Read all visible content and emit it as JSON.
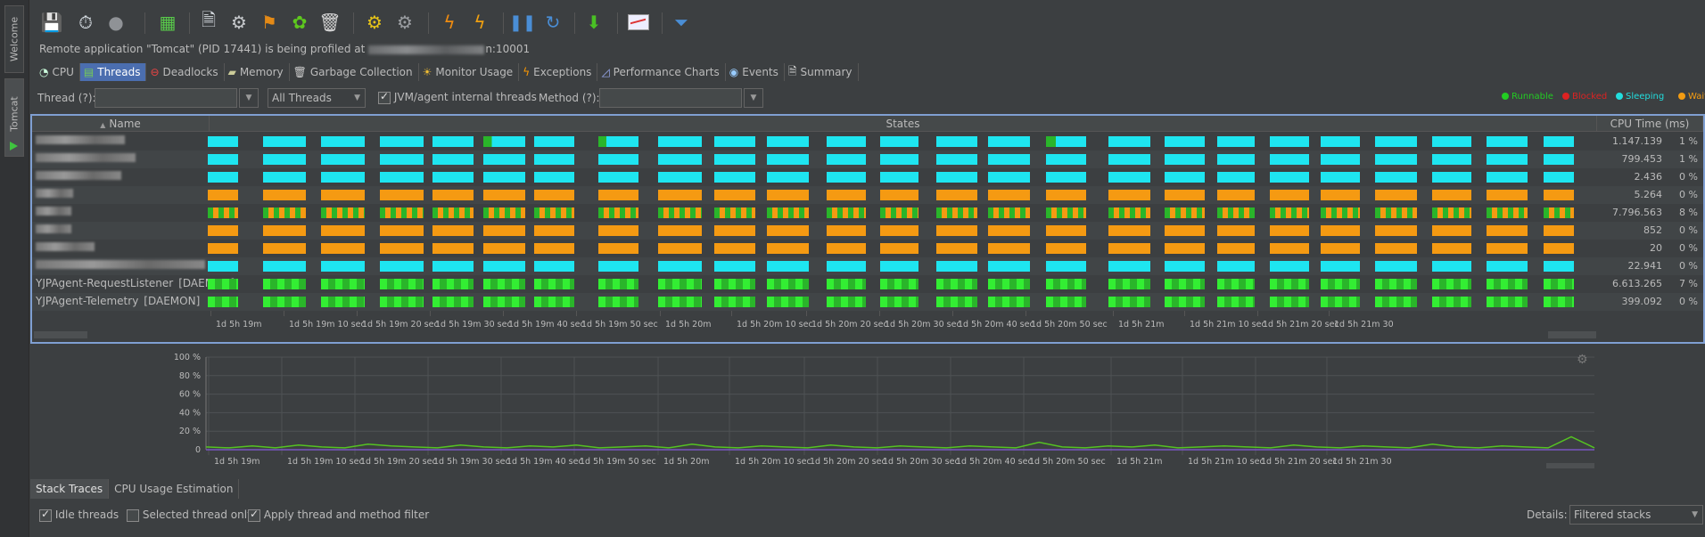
{
  "side_tabs": {
    "welcome": "Welcome",
    "tomcat": "Tomcat"
  },
  "toolbar": {
    "icons": [
      "save-snapshot-icon",
      "capture-performance-icon",
      "capture-memory-icon",
      "memory-snapshot-icon",
      "export-icon",
      "run-gc-icon",
      "flag-icon",
      "settings-gears-icon",
      "trash-icon",
      "cpu-gear-icon",
      "gear-icon",
      "lightning-icon",
      "lightning-star-icon",
      "pause-icon",
      "refresh-icon",
      "download-arrow-icon",
      "chart-icon",
      "filter-icon"
    ]
  },
  "status": {
    "prefix": "Remote application \"Tomcat\" (PID 17441) is being profiled at",
    "suffix": "n:10001"
  },
  "tabs": [
    {
      "label": "CPU",
      "icon": "cpu-icon",
      "active": false
    },
    {
      "label": "Threads",
      "icon": "threads-icon",
      "active": true
    },
    {
      "label": "Deadlocks",
      "icon": "deadlock-icon",
      "active": false
    },
    {
      "label": "Memory",
      "icon": "memory-icon",
      "active": false
    },
    {
      "label": "Garbage Collection",
      "icon": "gc-icon",
      "active": false
    },
    {
      "label": "Monitor Usage",
      "icon": "monitor-icon",
      "active": false
    },
    {
      "label": "Exceptions",
      "icon": "exception-icon",
      "active": false
    },
    {
      "label": "Performance Charts",
      "icon": "charts-icon",
      "active": false
    },
    {
      "label": "Events",
      "icon": "events-icon",
      "active": false
    },
    {
      "label": "Summary",
      "icon": "summary-icon",
      "active": false
    }
  ],
  "filter": {
    "thread_label": "Thread (?):",
    "thread_value": "",
    "thread_scope": "All Threads",
    "jvm_checkbox_label": "JVM/agent internal threads",
    "jvm_checked": true,
    "method_label": "Method (?):",
    "method_value": ""
  },
  "legend": [
    {
      "label": "Runnable",
      "color": "#22cc22"
    },
    {
      "label": "Blocked",
      "color": "#dd2222"
    },
    {
      "label": "Sleeping",
      "color": "#22dddd"
    },
    {
      "label": "Waiting",
      "color": "#f39c12"
    }
  ],
  "colors": {
    "runnable": "#2ab52a",
    "runnable_bright": "#33ee33",
    "sleeping": "#1ee5f0",
    "waiting": "#f59a12"
  },
  "table": {
    "headers": {
      "name": "Name",
      "states": "States",
      "cpu": "CPU Time (ms)"
    },
    "rows": [
      {
        "name": "",
        "blurred": true,
        "state": "sleeping",
        "cpu": "1.147.139",
        "pct": "1 %"
      },
      {
        "name": "",
        "blurred": true,
        "state": "sleeping",
        "cpu": "799.453",
        "pct": "1 %"
      },
      {
        "name": "",
        "blurred": true,
        "state": "sleeping",
        "cpu": "2.436",
        "pct": "0 %"
      },
      {
        "name": "",
        "blurred": true,
        "state": "waiting",
        "cpu": "5.264",
        "pct": "0 %"
      },
      {
        "name": "",
        "blurred": true,
        "state": "mixed",
        "cpu": "7.796.563",
        "pct": "8 %"
      },
      {
        "name": "",
        "blurred": true,
        "state": "waiting",
        "cpu": "852",
        "pct": "0 %"
      },
      {
        "name": "",
        "blurred": true,
        "state": "waiting",
        "cpu": "20",
        "pct": "0 %"
      },
      {
        "name": "",
        "blurred": true,
        "state": "sleeping",
        "cpu": "22.941",
        "pct": "0 %"
      },
      {
        "name": "YJPAgent-RequestListener",
        "tag": "[DAEMON]",
        "blurred": false,
        "state": "runnable",
        "cpu": "6.613.265",
        "pct": "7 %"
      },
      {
        "name": "YJPAgent-Telemetry",
        "tag": "[DAEMON]",
        "blurred": false,
        "state": "runnable",
        "cpu": "399.092",
        "pct": "0 %"
      }
    ]
  },
  "time_ticks": [
    "1d 5h 19m",
    "1d 5h 19m 10 sec",
    "1d 5h 19m 20 sec",
    "1d 5h 19m 30 sec",
    "1d 5h 19m 40 sec",
    "1d 5h 19m 50 sec",
    "1d 5h 20m",
    "1d 5h 20m 10 sec",
    "1d 5h 20m 20 sec",
    "1d 5h 20m 30 sec",
    "1d 5h 20m 40 sec",
    "1d 5h 20m 50 sec",
    "1d 5h 21m",
    "1d 5h 21m 10 sec",
    "1d 5h 21m 20 sec",
    "1d 5h 21m 30"
  ],
  "chart_data": {
    "type": "line",
    "ylabel": "",
    "yticks": [
      "100 %",
      "80 %",
      "60 %",
      "40 %",
      "20 %",
      "0"
    ],
    "ylim": [
      0,
      100
    ],
    "x": [
      "1d 5h 19m",
      "1d 5h 19m 10 sec",
      "1d 5h 19m 20 sec",
      "1d 5h 19m 30 sec",
      "1d 5h 19m 40 sec",
      "1d 5h 19m 50 sec",
      "1d 5h 20m",
      "1d 5h 20m 10 sec",
      "1d 5h 20m 20 sec",
      "1d 5h 20m 30 sec",
      "1d 5h 20m 40 sec",
      "1d 5h 20m 50 sec",
      "1d 5h 21m",
      "1d 5h 21m 10 sec",
      "1d 5h 21m 20 sec",
      "1d 5h 21m 30"
    ],
    "series": [
      {
        "color": "#55c222",
        "values": [
          3,
          2,
          4,
          2,
          5,
          3,
          2,
          6,
          4,
          3,
          2,
          5,
          3,
          2,
          4,
          3,
          5,
          2,
          3,
          4,
          2,
          6,
          3,
          2,
          4,
          3,
          2,
          5,
          3,
          2,
          4,
          3,
          2,
          4,
          3,
          2,
          8,
          3,
          2,
          4,
          3,
          5,
          2,
          3,
          4,
          3,
          2,
          5,
          3,
          2,
          4,
          3,
          2,
          6,
          3,
          2,
          4,
          3,
          2,
          14,
          2
        ]
      },
      {
        "color": "#7a55c2",
        "values": [
          0,
          0,
          0,
          0,
          0,
          0,
          0,
          0,
          0,
          0,
          0,
          0,
          0,
          0,
          0,
          0,
          0,
          0,
          0,
          0,
          0,
          0,
          0,
          0,
          0,
          0,
          0,
          0,
          0,
          0,
          0,
          0,
          0,
          0,
          0,
          0,
          0,
          0,
          0,
          0,
          0,
          0,
          0,
          0,
          0,
          0,
          0,
          0,
          0,
          0,
          0,
          0,
          0,
          0,
          0,
          0,
          0,
          0,
          0,
          0,
          0
        ]
      }
    ]
  },
  "bottom_tabs": [
    {
      "label": "Stack Traces",
      "active": true
    },
    {
      "label": "CPU Usage Estimation",
      "active": false
    }
  ],
  "bottom_options": {
    "idle_threads": {
      "label": "Idle threads",
      "checked": true
    },
    "selected_only": {
      "label": "Selected thread only",
      "checked": false
    },
    "apply_filter": {
      "label": "Apply thread and method filter",
      "checked": true
    },
    "details_label": "Details:",
    "details_value": "Filtered stacks"
  }
}
